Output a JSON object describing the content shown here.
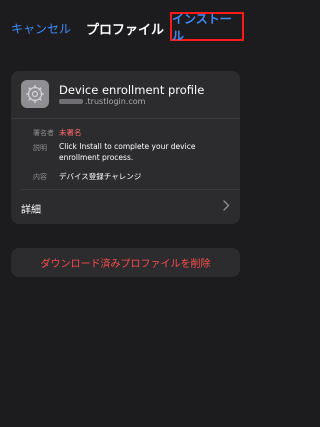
{
  "nav": {
    "cancel_label": "キャンセル",
    "title": "プロファイル",
    "install_label": "インストール"
  },
  "profile": {
    "icon": "gear-icon",
    "name": "Device enrollment profile",
    "org": ".trustlogin.com"
  },
  "info": {
    "signer_label": "署名者",
    "signer_value": "未署名",
    "description_label": "説明",
    "description_value": "Click Install to complete your device enrollment process.",
    "contents_label": "内容",
    "contents_value": "デバイス登録チャレンジ"
  },
  "details": {
    "label": "詳細",
    "chevron_icon": "chevron-right-icon"
  },
  "remove": {
    "label": "ダウンロード済みプロファイルを削除"
  },
  "colors": {
    "accent": "#3d8bfd",
    "destructive": "#ff4d4d",
    "highlight_border": "#ff1a1a",
    "background": "#1c1c1e",
    "card": "#2c2c2e"
  }
}
